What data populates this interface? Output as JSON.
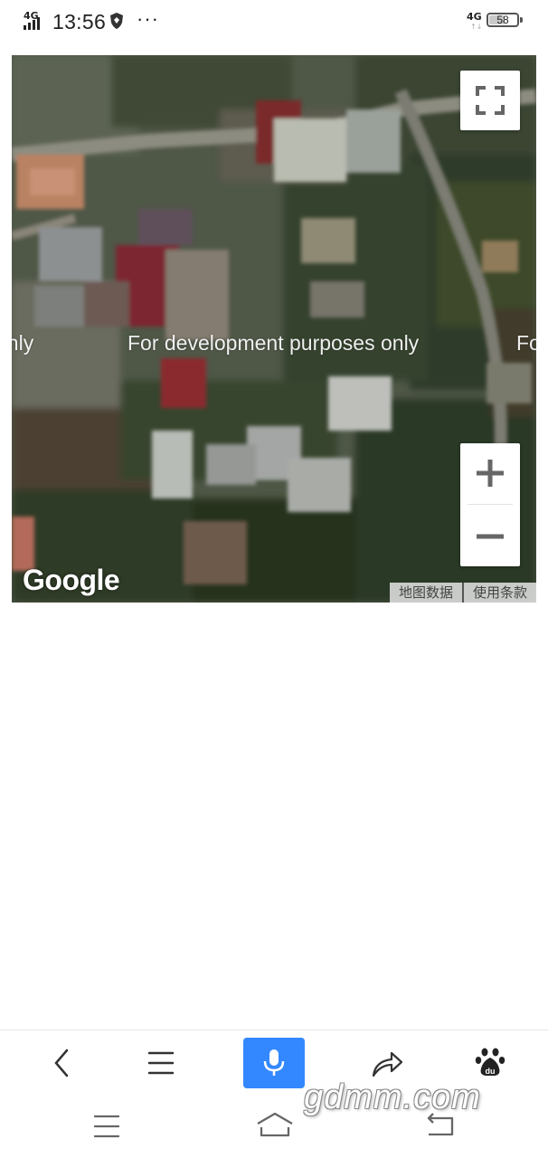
{
  "status_bar": {
    "network_left": "4G",
    "time": "13:56",
    "more": "···",
    "network_right": "4G",
    "network_right_arrows": "↑↓",
    "battery_level": "58",
    "battery_fraction": 0.58,
    "app_icon": "shield-app-icon"
  },
  "map": {
    "type": "satellite",
    "watermark_text": "For development purposes only",
    "watermark_fragment_left": "only",
    "watermark_fragment_right": "Fo",
    "logo_text": "Google",
    "attribution": {
      "map_data": "地图数据",
      "terms": "使用条款"
    },
    "controls": {
      "fullscreen_icon": "fullscreen-icon",
      "zoom_in_icon": "plus-icon",
      "zoom_out_icon": "minus-icon"
    }
  },
  "browser_toolbar": {
    "items": [
      {
        "name": "back",
        "icon": "chevron-left-icon"
      },
      {
        "name": "menu",
        "icon": "menu-icon"
      },
      {
        "name": "voice",
        "icon": "microphone-icon",
        "color": "#3388ff"
      },
      {
        "name": "share",
        "icon": "share-icon"
      },
      {
        "name": "baidu",
        "icon": "baidu-paw-icon",
        "label": "du"
      }
    ]
  },
  "system_nav": {
    "items": [
      "menu-icon",
      "home-icon",
      "back-icon"
    ]
  },
  "site_watermark": "gdmm.com"
}
